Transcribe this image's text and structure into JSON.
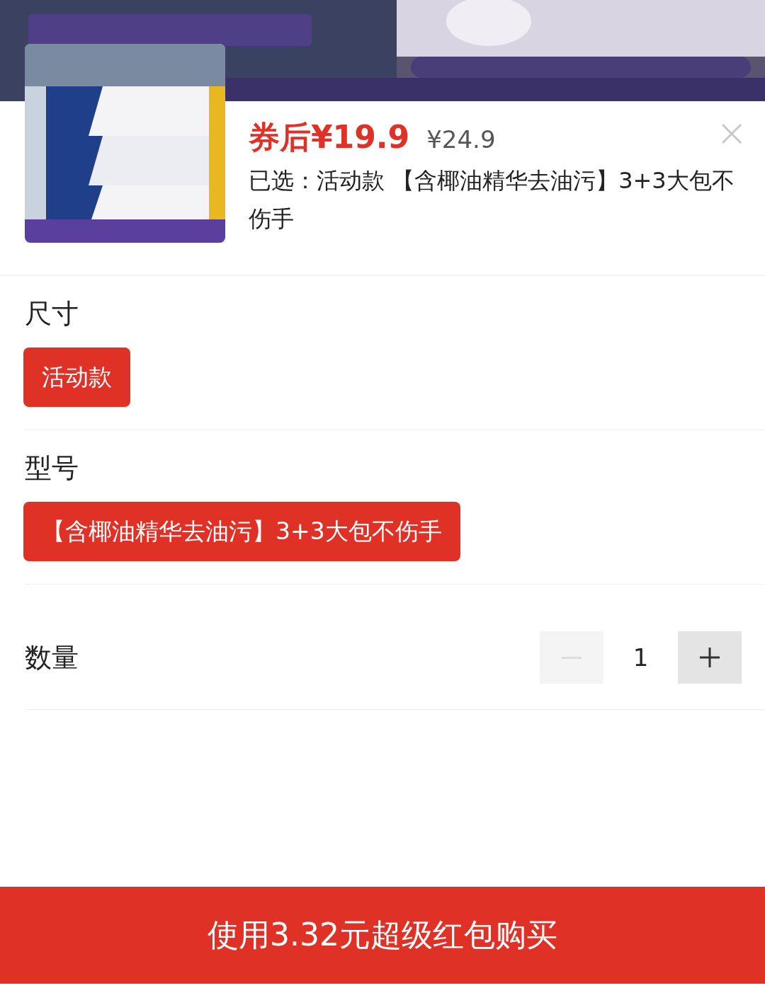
{
  "product": {
    "price_after_coupon": "券后¥19.9",
    "original_price": "¥24.9",
    "selected_text": "已选：活动款 【含椰油精华去油污】3+3大包不伤手"
  },
  "option_groups": [
    {
      "title": "尺寸",
      "options": [
        {
          "label": "活动款",
          "selected": true
        }
      ]
    },
    {
      "title": "型号",
      "options": [
        {
          "label": "【含椰油精华去油污】3+3大包不伤手",
          "selected": true
        }
      ]
    }
  ],
  "quantity": {
    "label": "数量",
    "value": "1",
    "decrement_disabled": true,
    "increment_disabled": false
  },
  "buy_button": "使用3.32元超级红包购买"
}
